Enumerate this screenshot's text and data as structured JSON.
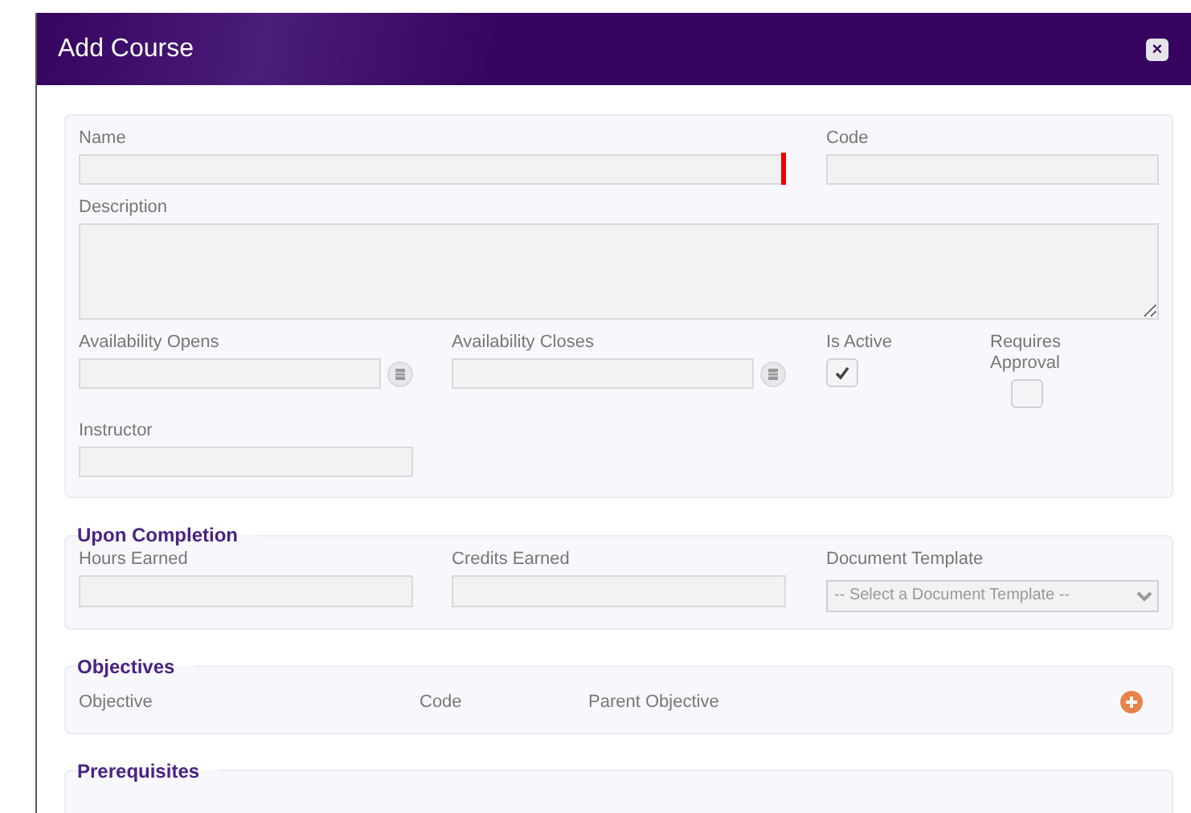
{
  "dialog": {
    "title": "Add Course",
    "close_label": "×"
  },
  "details": {
    "name": {
      "label": "Name",
      "required": true
    },
    "code": {
      "label": "Code"
    },
    "description": {
      "label": "Description"
    },
    "availability_opens": {
      "label": "Availability Opens"
    },
    "availability_closes": {
      "label": "Availability Closes"
    },
    "is_active": {
      "label": "Is Active",
      "checked": true
    },
    "requires_approval": {
      "label": "Requires Approval",
      "checked": false
    },
    "instructor": {
      "label": "Instructor"
    }
  },
  "upon_completion": {
    "title": "Upon Completion",
    "hours_label": "Hours Earned",
    "credits_label": "Credits Earned",
    "template_label": "Document Template",
    "template_placeholder": "-- Select a Document Template --"
  },
  "objectives": {
    "title": "Objectives",
    "columns": [
      "Objective",
      "Code",
      "Parent Objective"
    ]
  },
  "prerequisites": {
    "title": "Prerequisites"
  }
}
